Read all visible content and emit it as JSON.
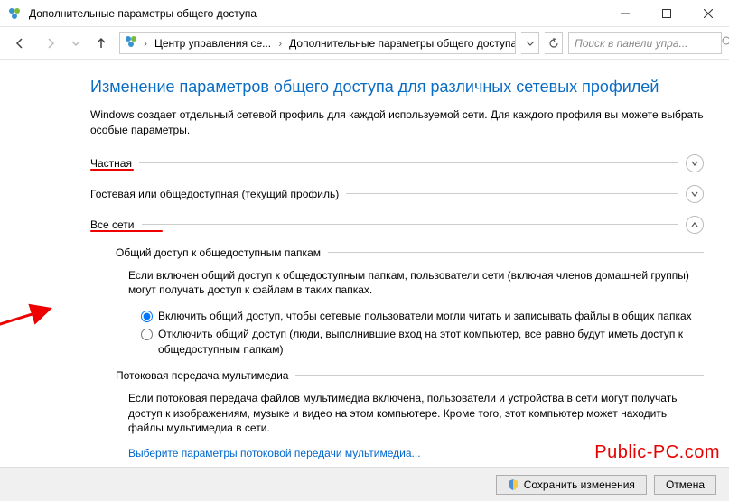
{
  "window": {
    "title": "Дополнительные параметры общего доступа"
  },
  "breadcrumb": {
    "parent": "Центр управления се...",
    "current": "Дополнительные параметры общего доступа"
  },
  "search": {
    "placeholder": "Поиск в панели упра..."
  },
  "page": {
    "heading": "Изменение параметров общего доступа для различных сетевых профилей",
    "intro": "Windows создает отдельный сетевой профиль для каждой используемой сети. Для каждого профиля вы можете выбрать особые параметры."
  },
  "sections": {
    "private": "Частная",
    "guest": "Гостевая или общедоступная (текущий профиль)",
    "all": "Все сети"
  },
  "public_folders": {
    "group_title": "Общий доступ к общедоступным папкам",
    "text": "Если включен общий доступ к общедоступным папкам, пользователи сети (включая членов домашней группы) могут получать доступ к файлам в таких папках.",
    "opt_on": "Включить общий доступ, чтобы сетевые пользователи могли читать и записывать файлы в общих папках",
    "opt_off": "Отключить общий доступ (люди, выполнившие вход на этот компьютер, все равно будут иметь доступ к общедоступным папкам)"
  },
  "media": {
    "group_title": "Потоковая передача мультимедиа",
    "text": "Если потоковая передача файлов мультимедиа включена, пользователи и устройства в сети могут получать доступ к изображениям, музыке и видео на этом компьютере. Кроме того, этот компьютер может находить файлы мультимедиа в сети.",
    "link": "Выберите параметры потоковой передачи мультимедиа..."
  },
  "footer": {
    "save": "Сохранить изменения",
    "cancel": "Отмена"
  },
  "watermark": "Public-PC.com"
}
